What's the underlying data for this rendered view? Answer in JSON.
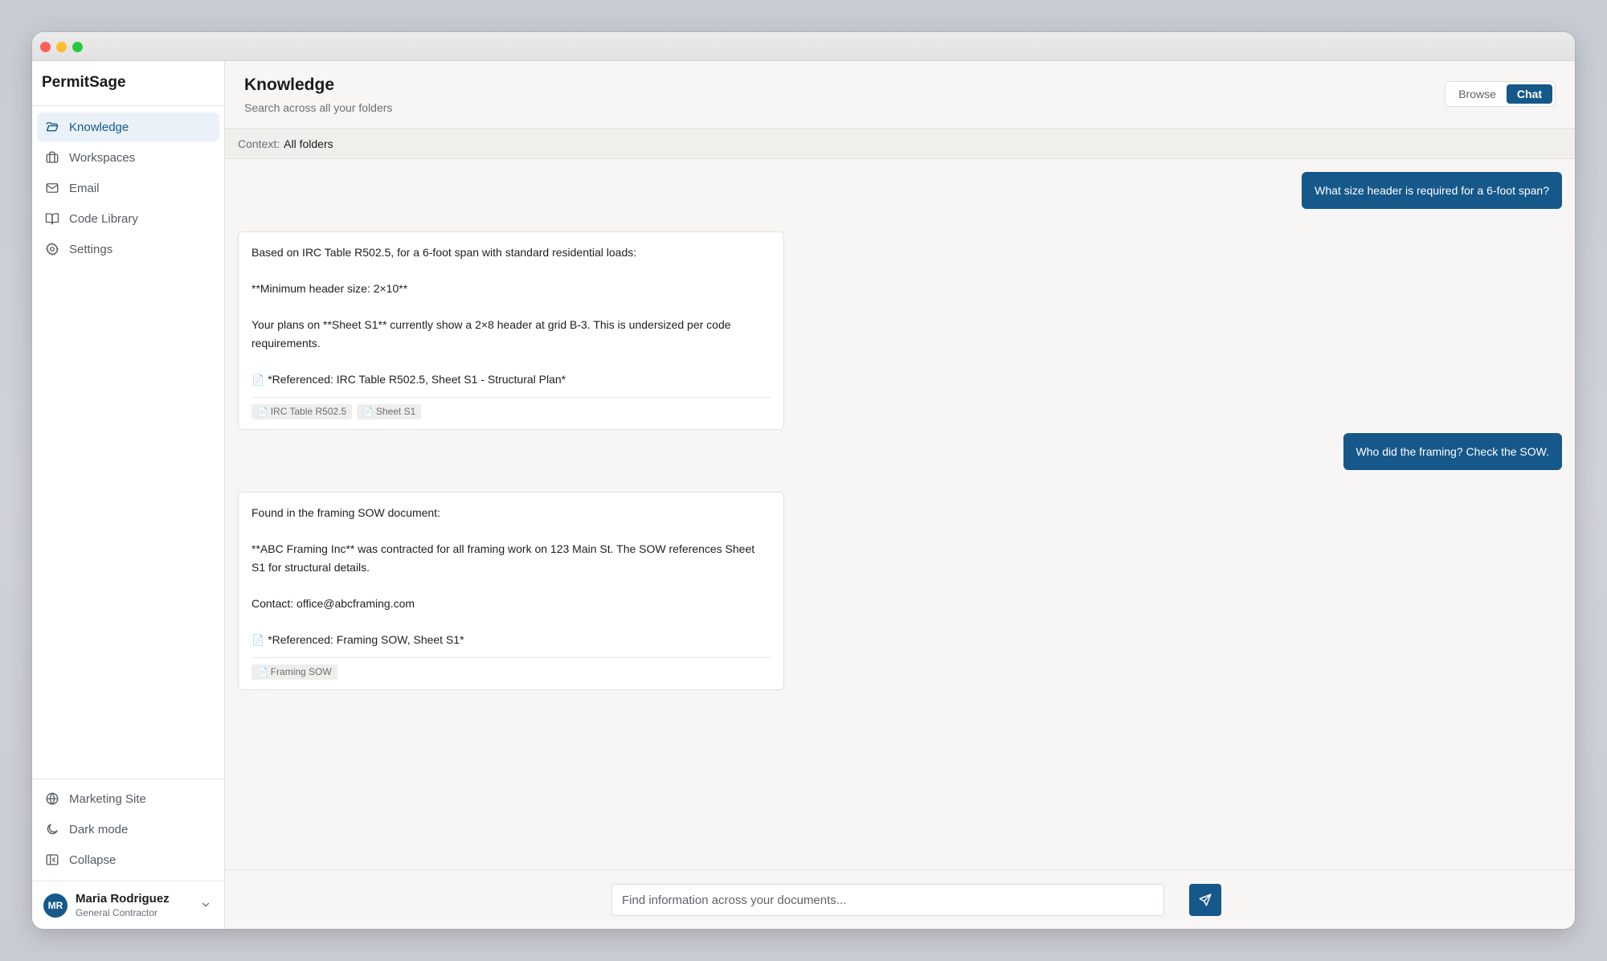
{
  "app": {
    "name": "PermitSage"
  },
  "sidebar": {
    "items": [
      {
        "label": "Knowledge",
        "icon": "folder-open-icon"
      },
      {
        "label": "Workspaces",
        "icon": "briefcase-icon"
      },
      {
        "label": "Email",
        "icon": "mail-icon"
      },
      {
        "label": "Code Library",
        "icon": "book-open-icon"
      },
      {
        "label": "Settings",
        "icon": "gear-icon"
      }
    ],
    "bottom_items": [
      {
        "label": "Marketing Site",
        "icon": "globe-icon"
      },
      {
        "label": "Dark mode",
        "icon": "moon-icon"
      },
      {
        "label": "Collapse",
        "icon": "collapse-icon"
      }
    ]
  },
  "user": {
    "initials": "MR",
    "name": "Maria Rodriguez",
    "role": "General Contractor"
  },
  "header": {
    "title": "Knowledge",
    "subtitle": "Search across all your folders",
    "view_toggle": {
      "browse": "Browse",
      "chat": "Chat",
      "active": "Chat"
    }
  },
  "context": {
    "label": "Context:",
    "value": "All folders"
  },
  "messages": [
    {
      "role": "user",
      "text": "What size header is required for a 6-foot span?"
    },
    {
      "role": "assistant",
      "paragraphs": [
        "Based on IRC Table R502.5, for a 6-foot span with standard residential loads:",
        "**Minimum header size: 2×10**",
        "Your plans on **Sheet S1** currently show a 2×8 header at grid B-3. This is undersized per code requirements."
      ],
      "reference": "*Referenced: IRC Table R502.5, Sheet S1 - Structural Plan*",
      "chips": [
        "IRC Table R502.5",
        "Sheet S1"
      ]
    },
    {
      "role": "user",
      "text": "Who did the framing? Check the SOW."
    },
    {
      "role": "assistant",
      "paragraphs": [
        "Found in the framing SOW document:",
        "**ABC Framing Inc** was contracted for all framing work on 123 Main St. The SOW references Sheet S1 for structural details.",
        "Contact: office@abcframing.com"
      ],
      "reference": "*Referenced: Framing SOW, Sheet S1*",
      "chips": [
        "Framing SOW"
      ]
    }
  ],
  "composer": {
    "placeholder": "Find information across your documents..."
  },
  "colors": {
    "accent": "#16588a",
    "active_nav_bg": "#eaf1f8"
  }
}
